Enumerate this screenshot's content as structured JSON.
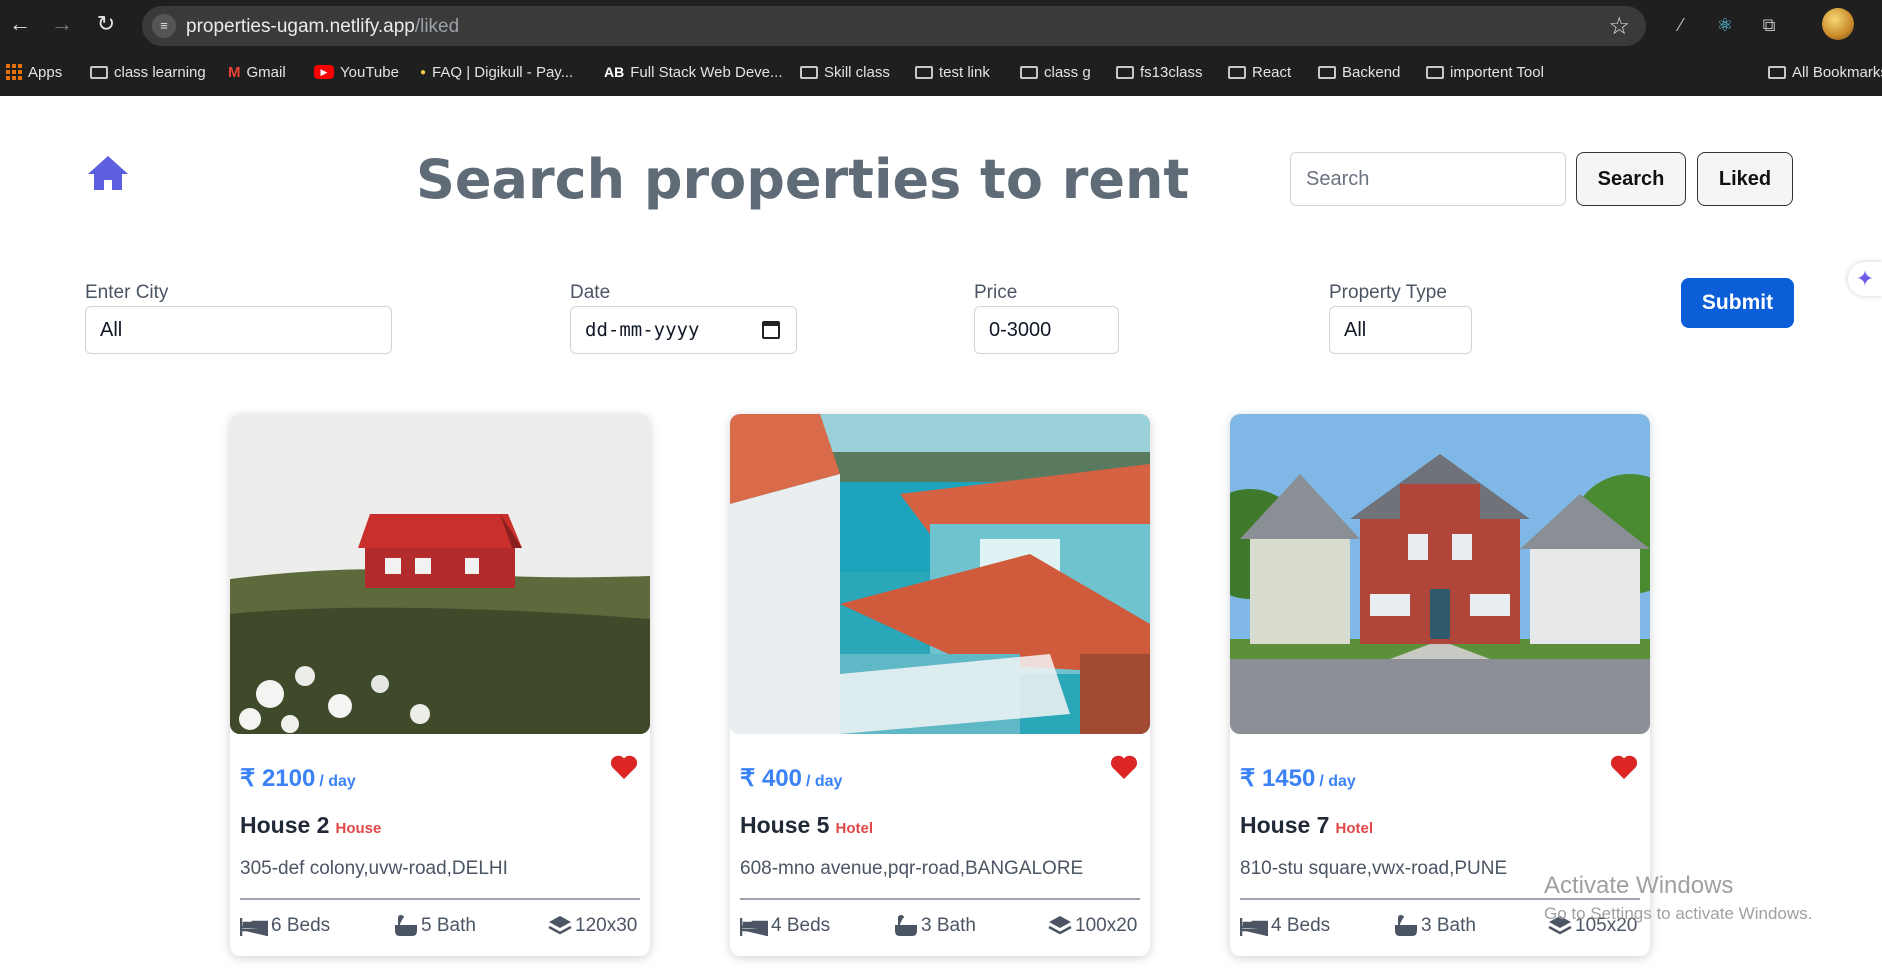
{
  "browser": {
    "url_host": "properties-ugam.netlify.app",
    "url_path": "/liked",
    "bookmarks": [
      {
        "label": "Apps",
        "icon": "apps-grid-icon"
      },
      {
        "label": "class learning",
        "icon": "folder-icon"
      },
      {
        "label": "Gmail",
        "icon": "gmail-icon"
      },
      {
        "label": "YouTube",
        "icon": "youtube-icon"
      },
      {
        "label": "FAQ | Digikull - Pay...",
        "icon": "digikull-icon"
      },
      {
        "label": "Full Stack Web Deve...",
        "icon": "ab-icon"
      },
      {
        "label": "Skill class",
        "icon": "folder-icon"
      },
      {
        "label": "test link",
        "icon": "folder-icon"
      },
      {
        "label": "class g",
        "icon": "folder-icon"
      },
      {
        "label": "fs13class",
        "icon": "folder-icon"
      },
      {
        "label": "React",
        "icon": "folder-icon"
      },
      {
        "label": "Backend",
        "icon": "folder-icon"
      },
      {
        "label": "importent Tool",
        "icon": "folder-icon"
      },
      {
        "label": "All Bookmarks",
        "icon": "folder-icon"
      }
    ]
  },
  "header": {
    "title": "Search properties to rent",
    "search_placeholder": "Search",
    "search_button": "Search",
    "liked_button": "Liked"
  },
  "filters": {
    "city_label": "Enter City",
    "city_value": "All",
    "date_label": "Date",
    "date_value": "dd-mm-yyyy",
    "price_label": "Price",
    "price_value": "0-3000",
    "type_label": "Property Type",
    "type_value": "All",
    "submit": "Submit"
  },
  "cards": [
    {
      "price": "₹ 2100",
      "per": "/ day",
      "name": "House 2",
      "type": "House",
      "address": "305-def colony,uvw-road,DELHI",
      "beds": "6 Beds",
      "bath": "5 Bath",
      "size": "120x30",
      "liked": true,
      "image": "red-cabin-on-meadow"
    },
    {
      "price": "₹ 400",
      "per": "/ day",
      "name": "House 5",
      "type": "Hotel",
      "address": "608-mno avenue,pqr-road,BANGALORE",
      "beds": "4 Beds",
      "bath": "3 Bath",
      "size": "100x20",
      "liked": true,
      "image": "blue-house-by-sea"
    },
    {
      "price": "₹ 1450",
      "per": "/ day",
      "name": "House 7",
      "type": "Hotel",
      "address": "810-stu square,vwx-road,PUNE",
      "beds": "4 Beds",
      "bath": "3 Bath",
      "size": "105x20",
      "liked": true,
      "image": "red-suburban-house"
    }
  ],
  "watermark": {
    "line1": "Activate Windows",
    "line2": "Go to Settings to activate Windows."
  },
  "colors": {
    "accent": "#0b5ed7",
    "price": "#3b82f6",
    "heart": "#dc2626",
    "type_tag": "#e04848",
    "home_icon": "#5b5fe0"
  }
}
